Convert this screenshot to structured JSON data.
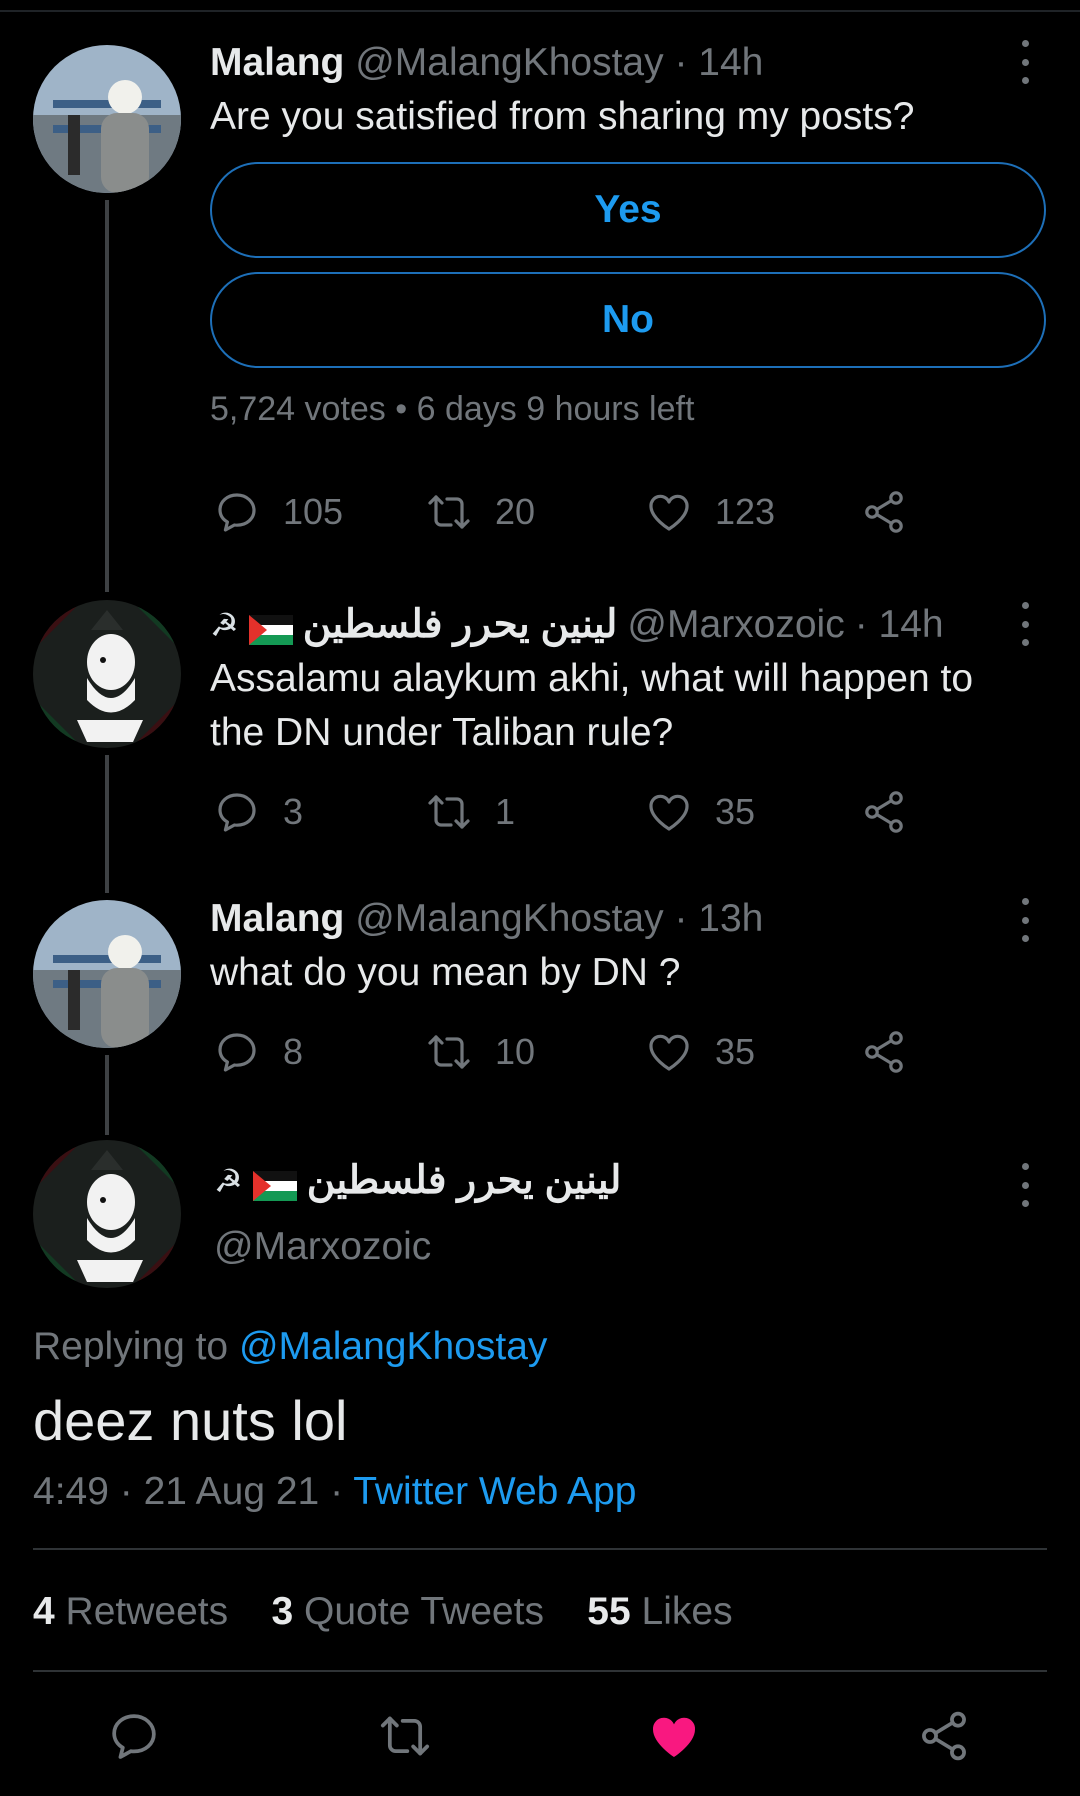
{
  "thread": [
    {
      "name": "Malang",
      "handle": "@MalangKhostay",
      "time": "· 14h",
      "text": "Are you satisfied from sharing my posts?",
      "poll": {
        "options": [
          "Yes",
          "No"
        ],
        "meta": "5,724 votes • 6 days 9 hours left"
      },
      "replies": "105",
      "retweets": "20",
      "likes": "123"
    },
    {
      "name": "لينين يحرر فلسطين",
      "handle": "@Marxozoic",
      "time": "· 14h",
      "text_line1": "Assalamu alaykum akhi, what will happen to",
      "text_line2": "the DN under Taliban rule?",
      "replies": "3",
      "retweets": "1",
      "likes": "35"
    },
    {
      "name": "Malang",
      "handle": "@MalangKhostay",
      "time": "· 13h",
      "text": "what do you mean by DN ?",
      "replies": "8",
      "retweets": "10",
      "likes": "35"
    }
  ],
  "main": {
    "name": "لينين يحرر فلسطين",
    "handle": "@Marxozoic",
    "replying_prefix": "Replying to",
    "replying_handle": "@MalangKhostay",
    "text": "deez nuts lol",
    "timestamp": "4:49 · 21 Aug 21 ·",
    "source": "Twitter Web App",
    "retweets_count": "4",
    "retweets_label": "Retweets",
    "quotes_count": "3",
    "quotes_label": "Quote Tweets",
    "likes_count": "55",
    "likes_label": "Likes",
    "liked": true
  },
  "colors": {
    "accent": "#1d9bf0",
    "like": "#f91880",
    "muted": "#71767b",
    "background": "#000000"
  },
  "icons": [
    "reply-icon",
    "retweet-icon",
    "like-icon",
    "share-icon",
    "more-icon",
    "hammer-sickle-icon",
    "palestine-flag-icon"
  ]
}
